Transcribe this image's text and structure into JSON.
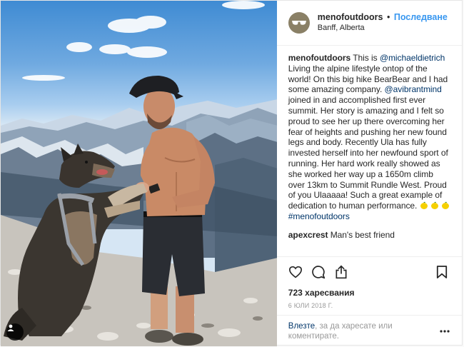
{
  "post": {
    "username": "menofoutdoors",
    "separator": "•",
    "follow_label": "Последване",
    "location": "Banff, Alberta",
    "caption": {
      "username": "menofoutdoors",
      "part1": "This is ",
      "mention1": "@michaeldietrich",
      "part2": " Living the alpine lifestyle ontop of the world! On this big hike BearBear and I had some amazing company. ",
      "mention2": "@avibrantmind",
      "part3": " joined in and accomplished first ever summit. Her story is amazing and I felt so proud to see her up there overcoming her fear of heights and pushing her new found legs and body. Recently Ula has fully invested herself into her newfound sport of running. Her hard work really showed as she worked her way up a 1650m climb over 13km to Summit Rundle West. Proud of you Ulaaaaa! Such a great example of dedication to human performance. ",
      "hashtag": "#menofoutdoors"
    },
    "comments": [
      {
        "username": "apexcrest",
        "text": "Man's best friend"
      }
    ],
    "likes_text": "723 харесвания",
    "date_text": "6 юли 2018 г.",
    "add_comment": {
      "login_label": "Влезте",
      "rest_text": ", за да харесате или коментирате."
    },
    "icons": {
      "like": "heart-icon",
      "comment": "comment-icon",
      "share": "share-icon",
      "save": "bookmark-icon",
      "more": "more-options-icon",
      "tag": "user-tag-icon"
    },
    "colors": {
      "link": "#003569",
      "follow": "#3897f0",
      "emoji": "#f5d000"
    }
  }
}
